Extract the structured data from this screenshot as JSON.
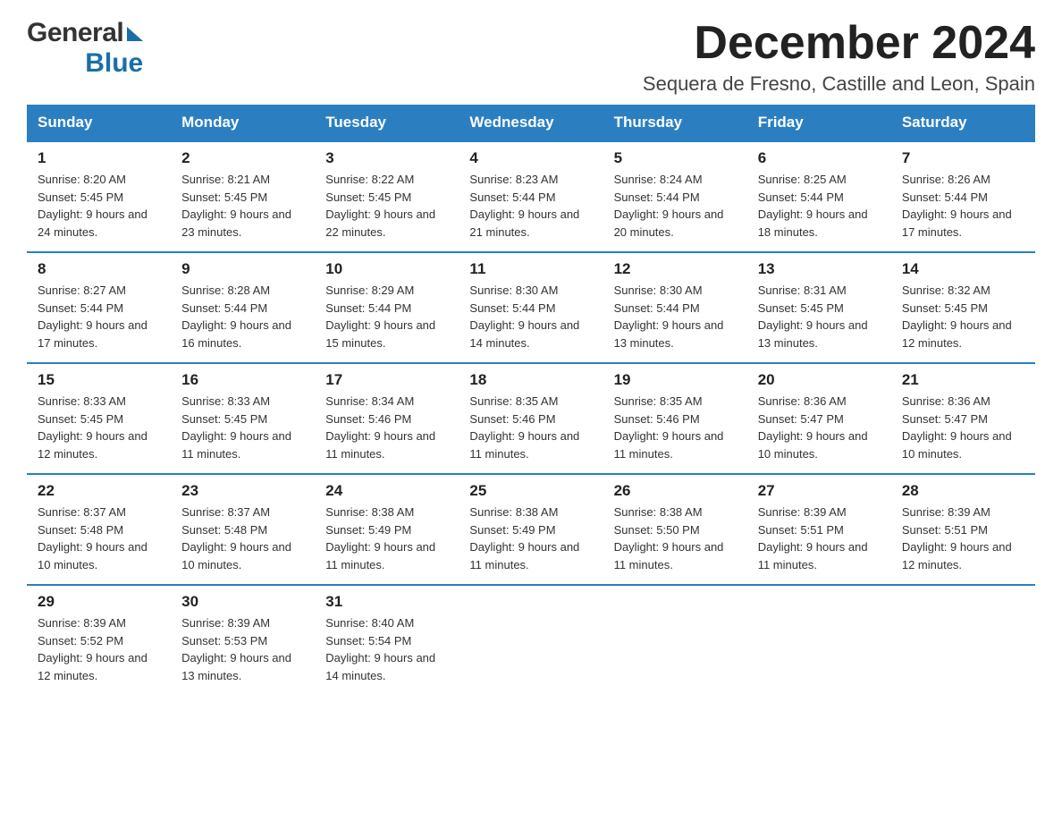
{
  "header": {
    "logo_general": "General",
    "logo_blue": "Blue",
    "month_title": "December 2024",
    "location": "Sequera de Fresno, Castille and Leon, Spain"
  },
  "days_of_week": [
    "Sunday",
    "Monday",
    "Tuesday",
    "Wednesday",
    "Thursday",
    "Friday",
    "Saturday"
  ],
  "weeks": [
    [
      {
        "day": "1",
        "sunrise": "Sunrise: 8:20 AM",
        "sunset": "Sunset: 5:45 PM",
        "daylight": "Daylight: 9 hours and 24 minutes."
      },
      {
        "day": "2",
        "sunrise": "Sunrise: 8:21 AM",
        "sunset": "Sunset: 5:45 PM",
        "daylight": "Daylight: 9 hours and 23 minutes."
      },
      {
        "day": "3",
        "sunrise": "Sunrise: 8:22 AM",
        "sunset": "Sunset: 5:45 PM",
        "daylight": "Daylight: 9 hours and 22 minutes."
      },
      {
        "day": "4",
        "sunrise": "Sunrise: 8:23 AM",
        "sunset": "Sunset: 5:44 PM",
        "daylight": "Daylight: 9 hours and 21 minutes."
      },
      {
        "day": "5",
        "sunrise": "Sunrise: 8:24 AM",
        "sunset": "Sunset: 5:44 PM",
        "daylight": "Daylight: 9 hours and 20 minutes."
      },
      {
        "day": "6",
        "sunrise": "Sunrise: 8:25 AM",
        "sunset": "Sunset: 5:44 PM",
        "daylight": "Daylight: 9 hours and 18 minutes."
      },
      {
        "day": "7",
        "sunrise": "Sunrise: 8:26 AM",
        "sunset": "Sunset: 5:44 PM",
        "daylight": "Daylight: 9 hours and 17 minutes."
      }
    ],
    [
      {
        "day": "8",
        "sunrise": "Sunrise: 8:27 AM",
        "sunset": "Sunset: 5:44 PM",
        "daylight": "Daylight: 9 hours and 17 minutes."
      },
      {
        "day": "9",
        "sunrise": "Sunrise: 8:28 AM",
        "sunset": "Sunset: 5:44 PM",
        "daylight": "Daylight: 9 hours and 16 minutes."
      },
      {
        "day": "10",
        "sunrise": "Sunrise: 8:29 AM",
        "sunset": "Sunset: 5:44 PM",
        "daylight": "Daylight: 9 hours and 15 minutes."
      },
      {
        "day": "11",
        "sunrise": "Sunrise: 8:30 AM",
        "sunset": "Sunset: 5:44 PM",
        "daylight": "Daylight: 9 hours and 14 minutes."
      },
      {
        "day": "12",
        "sunrise": "Sunrise: 8:30 AM",
        "sunset": "Sunset: 5:44 PM",
        "daylight": "Daylight: 9 hours and 13 minutes."
      },
      {
        "day": "13",
        "sunrise": "Sunrise: 8:31 AM",
        "sunset": "Sunset: 5:45 PM",
        "daylight": "Daylight: 9 hours and 13 minutes."
      },
      {
        "day": "14",
        "sunrise": "Sunrise: 8:32 AM",
        "sunset": "Sunset: 5:45 PM",
        "daylight": "Daylight: 9 hours and 12 minutes."
      }
    ],
    [
      {
        "day": "15",
        "sunrise": "Sunrise: 8:33 AM",
        "sunset": "Sunset: 5:45 PM",
        "daylight": "Daylight: 9 hours and 12 minutes."
      },
      {
        "day": "16",
        "sunrise": "Sunrise: 8:33 AM",
        "sunset": "Sunset: 5:45 PM",
        "daylight": "Daylight: 9 hours and 11 minutes."
      },
      {
        "day": "17",
        "sunrise": "Sunrise: 8:34 AM",
        "sunset": "Sunset: 5:46 PM",
        "daylight": "Daylight: 9 hours and 11 minutes."
      },
      {
        "day": "18",
        "sunrise": "Sunrise: 8:35 AM",
        "sunset": "Sunset: 5:46 PM",
        "daylight": "Daylight: 9 hours and 11 minutes."
      },
      {
        "day": "19",
        "sunrise": "Sunrise: 8:35 AM",
        "sunset": "Sunset: 5:46 PM",
        "daylight": "Daylight: 9 hours and 11 minutes."
      },
      {
        "day": "20",
        "sunrise": "Sunrise: 8:36 AM",
        "sunset": "Sunset: 5:47 PM",
        "daylight": "Daylight: 9 hours and 10 minutes."
      },
      {
        "day": "21",
        "sunrise": "Sunrise: 8:36 AM",
        "sunset": "Sunset: 5:47 PM",
        "daylight": "Daylight: 9 hours and 10 minutes."
      }
    ],
    [
      {
        "day": "22",
        "sunrise": "Sunrise: 8:37 AM",
        "sunset": "Sunset: 5:48 PM",
        "daylight": "Daylight: 9 hours and 10 minutes."
      },
      {
        "day": "23",
        "sunrise": "Sunrise: 8:37 AM",
        "sunset": "Sunset: 5:48 PM",
        "daylight": "Daylight: 9 hours and 10 minutes."
      },
      {
        "day": "24",
        "sunrise": "Sunrise: 8:38 AM",
        "sunset": "Sunset: 5:49 PM",
        "daylight": "Daylight: 9 hours and 11 minutes."
      },
      {
        "day": "25",
        "sunrise": "Sunrise: 8:38 AM",
        "sunset": "Sunset: 5:49 PM",
        "daylight": "Daylight: 9 hours and 11 minutes."
      },
      {
        "day": "26",
        "sunrise": "Sunrise: 8:38 AM",
        "sunset": "Sunset: 5:50 PM",
        "daylight": "Daylight: 9 hours and 11 minutes."
      },
      {
        "day": "27",
        "sunrise": "Sunrise: 8:39 AM",
        "sunset": "Sunset: 5:51 PM",
        "daylight": "Daylight: 9 hours and 11 minutes."
      },
      {
        "day": "28",
        "sunrise": "Sunrise: 8:39 AM",
        "sunset": "Sunset: 5:51 PM",
        "daylight": "Daylight: 9 hours and 12 minutes."
      }
    ],
    [
      {
        "day": "29",
        "sunrise": "Sunrise: 8:39 AM",
        "sunset": "Sunset: 5:52 PM",
        "daylight": "Daylight: 9 hours and 12 minutes."
      },
      {
        "day": "30",
        "sunrise": "Sunrise: 8:39 AM",
        "sunset": "Sunset: 5:53 PM",
        "daylight": "Daylight: 9 hours and 13 minutes."
      },
      {
        "day": "31",
        "sunrise": "Sunrise: 8:40 AM",
        "sunset": "Sunset: 5:54 PM",
        "daylight": "Daylight: 9 hours and 14 minutes."
      },
      null,
      null,
      null,
      null
    ]
  ]
}
